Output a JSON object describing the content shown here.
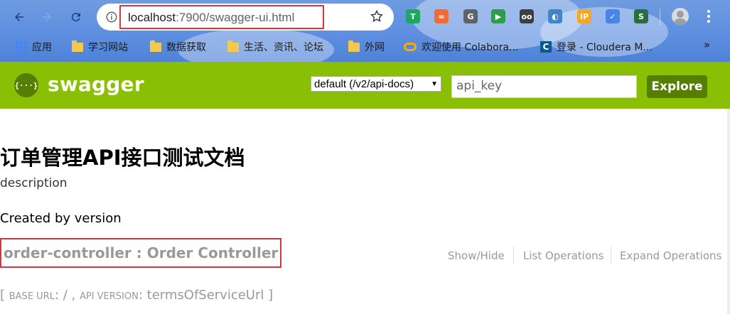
{
  "browser": {
    "url_host": "localhost",
    "url_path": ":7900/swagger-ui.html",
    "extensions": [
      {
        "name": "tampermonkey-icon",
        "label": "T",
        "color": "#1ea85c"
      },
      {
        "name": "infinity-icon",
        "label": "∞",
        "color": "#f16b36"
      },
      {
        "name": "translate-icon",
        "label": "G",
        "color": "#5f6368"
      },
      {
        "name": "shield-icon",
        "label": "▶",
        "color": "#2e9d49"
      },
      {
        "name": "glasses-icon",
        "label": "oo",
        "color": "#3c4043"
      },
      {
        "name": "globe-icon",
        "label": "◐",
        "color": "#3f86c8"
      },
      {
        "name": "ip-icon",
        "label": "IP",
        "color": "#f6a623"
      },
      {
        "name": "bird-icon",
        "label": "✓",
        "color": "#4b84e8"
      },
      {
        "name": "s-extension-icon",
        "label": "S",
        "color": "#2b6d3e"
      }
    ],
    "bookmarks": [
      {
        "name": "bookmark-apps",
        "label": "应用",
        "icon": "apps-grid-icon"
      },
      {
        "name": "bookmark-study",
        "label": "学习网站",
        "icon": "folder-icon"
      },
      {
        "name": "bookmark-data",
        "label": "数据获取",
        "icon": "folder-icon"
      },
      {
        "name": "bookmark-life",
        "label": "生活、资讯、论坛",
        "icon": "folder-icon"
      },
      {
        "name": "bookmark-foreign",
        "label": "外网",
        "icon": "folder-icon"
      },
      {
        "name": "bookmark-colab",
        "label": "欢迎使用 Colabora...",
        "icon": "colab-icon"
      },
      {
        "name": "bookmark-cloudera",
        "label": "登录 - Cloudera M...",
        "icon": "cloudera-icon"
      }
    ],
    "bookmarks_more": "»"
  },
  "swagger": {
    "logo_text": "swagger",
    "logo_glyph": "{···}",
    "spec_select": "default (/v2/api-docs)",
    "api_key_placeholder": "api_key",
    "explore_label": "Explore"
  },
  "content": {
    "title": "订单管理API接口测试文档",
    "description": "description",
    "created_by": "Created by version",
    "controller": "order-controller : Order Controller",
    "operations": {
      "show_hide": "Show/Hide",
      "list": "List Operations",
      "expand": "Expand Operations"
    },
    "base_url_label": "Base url",
    "base_url_value": ": / , ",
    "api_version_label": "Api version",
    "api_version_value": ": termsOfServiceUrl ]",
    "open_bracket": "[ "
  },
  "colors": {
    "swagger_green": "#89bf04",
    "explore_green": "#547f00",
    "highlight_red": "#d9333c"
  }
}
